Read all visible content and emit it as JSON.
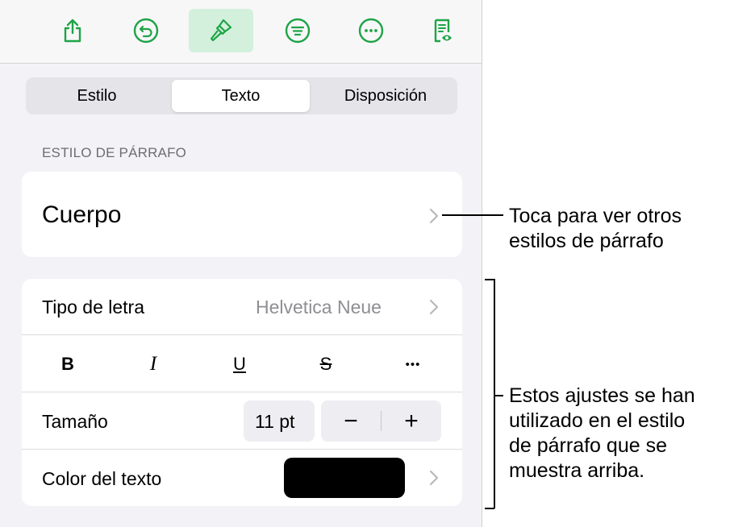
{
  "toolbar": {
    "buttons": [
      {
        "icon": "share-icon"
      },
      {
        "icon": "undo-icon"
      },
      {
        "icon": "paintbrush-icon",
        "active": true
      },
      {
        "icon": "format-list-icon"
      },
      {
        "icon": "more-icon"
      },
      {
        "icon": "document-view-icon"
      }
    ],
    "accent": "#1ea446"
  },
  "tabs": [
    {
      "label": "Estilo"
    },
    {
      "label": "Texto",
      "selected": true
    },
    {
      "label": "Disposición"
    }
  ],
  "paragraph_section": {
    "header": "ESTILO DE PÁRRAFO",
    "style_name": "Cuerpo"
  },
  "font_settings": {
    "font_label": "Tipo de letra",
    "font_value": "Helvetica Neue",
    "format_buttons": [
      {
        "glyph": "B",
        "icon": "bold-icon"
      },
      {
        "glyph": "I",
        "icon": "italic-icon"
      },
      {
        "glyph": "U",
        "icon": "underline-icon"
      },
      {
        "glyph": "S",
        "icon": "strikethrough-icon"
      },
      {
        "glyph": "•••",
        "icon": "more-options-icon"
      }
    ],
    "size_label": "Tamaño",
    "size_value": "11 pt",
    "decrease": "−",
    "increase": "+",
    "color_label": "Color del texto",
    "color_value": "#000000"
  },
  "annotations": {
    "callout_1": [
      "Toca para ver otros",
      "estilos de párrafo"
    ],
    "callout_2": [
      "Estos ajustes se han",
      "utilizado en el estilo",
      "de párrafo que se",
      "muestra arriba."
    ]
  }
}
